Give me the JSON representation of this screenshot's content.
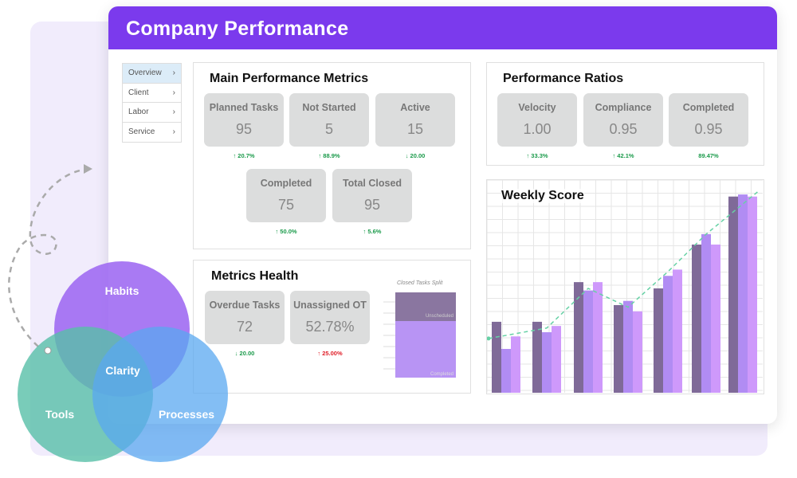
{
  "header": {
    "title": "Company Performance"
  },
  "sidebar": {
    "items": [
      {
        "label": "Overview",
        "active": true
      },
      {
        "label": "Client"
      },
      {
        "label": "Labor"
      },
      {
        "label": "Service"
      }
    ]
  },
  "main_metrics": {
    "title": "Main Performance Metrics",
    "cards": [
      {
        "label": "Planned Tasks",
        "value": "95",
        "change": "↑ 20.7%"
      },
      {
        "label": "Not Started",
        "value": "5",
        "change": "↑ 88.9%"
      },
      {
        "label": "Active",
        "value": "15",
        "change": "↓ 20.00"
      },
      {
        "label": "Completed",
        "value": "75",
        "change": "↑ 50.0%"
      },
      {
        "label": "Total Closed",
        "value": "95",
        "change": "↑ 5.6%"
      }
    ]
  },
  "ratios": {
    "title": "Performance Ratios",
    "cards": [
      {
        "label": "Velocity",
        "value": "1.00",
        "change": "↑ 33.3%"
      },
      {
        "label": "Compliance",
        "value": "0.95",
        "change": "↑ 42.1%"
      },
      {
        "label": "Completed",
        "value": "0.95",
        "change": "89.47%"
      }
    ]
  },
  "health": {
    "title": "Metrics Health",
    "cards": [
      {
        "label": "Overdue Tasks",
        "value": "72",
        "change": "↓ 20.00",
        "status": "good"
      },
      {
        "label": "Unassigned OT",
        "value": "52.78%",
        "change": "↑ 25.00%",
        "status": "bad"
      }
    ],
    "split": {
      "title": "Closed Tasks Split",
      "segments": [
        {
          "label": "Unscheduled",
          "share": 0.34,
          "color": "#8a76a0"
        },
        {
          "label": "Completed",
          "share": 0.66,
          "color": "#b894f4"
        }
      ]
    }
  },
  "chart_data": {
    "type": "bar",
    "title": "Weekly Score",
    "groups": 7,
    "series": [
      {
        "color": "#7f6a98",
        "values": [
          34,
          34,
          53,
          42,
          50,
          71,
          94
        ]
      },
      {
        "color": "#b18cf3",
        "values": [
          21,
          29,
          49,
          44,
          56,
          76,
          95
        ]
      },
      {
        "color": "#ce99fb",
        "values": [
          27,
          32,
          53,
          39,
          59,
          71,
          94
        ]
      }
    ],
    "trend": {
      "color": "#66d1a5",
      "values": [
        26,
        31,
        50,
        41,
        58,
        76,
        97
      ]
    },
    "ylim": [
      0,
      100
    ],
    "grid": true
  },
  "venn": {
    "circles": [
      {
        "label": "Habits",
        "color": "#a06cf2"
      },
      {
        "label": "Tools",
        "color": "#57bfa8"
      },
      {
        "label": "Processes",
        "color": "#5aa8f0"
      }
    ],
    "center": "Clarity"
  },
  "colors": {
    "accent": "#7b3aed",
    "positive": "#1a9a4a",
    "negative": "#e0202a"
  }
}
